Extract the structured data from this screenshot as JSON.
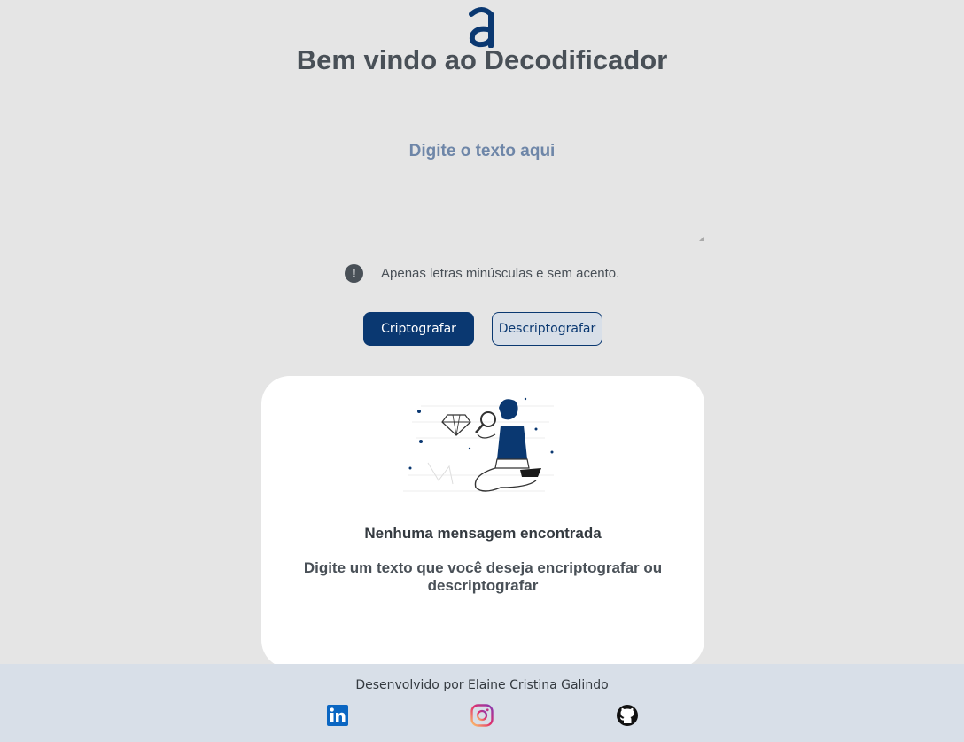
{
  "header": {
    "logo_icon": "alura-logo-icon",
    "title": "Bem vindo ao Decodificador"
  },
  "input": {
    "placeholder": "Digite o texto aqui",
    "value": ""
  },
  "hint": {
    "icon": "exclamation-circle-icon",
    "text": "Apenas letras minúsculas e sem acento."
  },
  "actions": {
    "encrypt_label": "Criptografar",
    "decrypt_label": "Descriptografar"
  },
  "output": {
    "illustration": "person-with-magnifier-diamond-illustration",
    "title": "Nenhuma mensagem encontrada",
    "message": "Digite um texto que você deseja encriptografar ou descriptografar"
  },
  "footer": {
    "credit": "Desenvolvido por Elaine Cristina Galindo",
    "links": [
      {
        "name": "linkedin",
        "icon": "linkedin-icon"
      },
      {
        "name": "instagram",
        "icon": "instagram-icon"
      },
      {
        "name": "github",
        "icon": "github-icon"
      }
    ]
  },
  "colors": {
    "primary": "#0a3871",
    "background": "#e5e5e5",
    "footer_bg": "#d8dfe8",
    "heading": "#495057",
    "placeholder": "#6e86a8"
  }
}
